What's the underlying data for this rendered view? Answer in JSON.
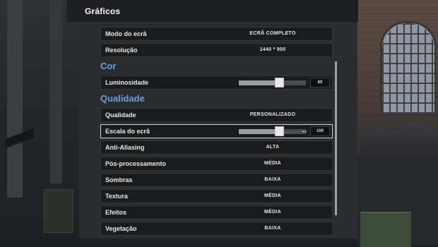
{
  "panel": {
    "title": "Gráficos"
  },
  "rows_top": [
    {
      "label": "Modo do ecrã",
      "value": "ECRÃ COMPLETO"
    },
    {
      "label": "Resolução",
      "value": "1440 * 900"
    }
  ],
  "sections": {
    "color": "Cor",
    "quality": "Qualidade"
  },
  "brightness": {
    "label": "Luminosidade",
    "value": "60",
    "fraction": 0.6
  },
  "quality_preset": {
    "label": "Qualidade",
    "value": "PERSONALIZADO"
  },
  "screen_scale": {
    "label": "Escala do ecrã",
    "value": "100",
    "fraction": 0.6
  },
  "rows_quality": [
    {
      "label": "Anti-Aliasing",
      "value": "ALTA"
    },
    {
      "label": "Pós-processamento",
      "value": "MÉDIA"
    },
    {
      "label": "Sombras",
      "value": "BAIXA"
    },
    {
      "label": "Textura",
      "value": "MÉDIA"
    },
    {
      "label": "Efeitos",
      "value": "MÉDIA"
    },
    {
      "label": "Vegetação",
      "value": "BAIXA"
    }
  ],
  "colors": {
    "section_accent": "#6aa1dc",
    "panel_bg": "#2a2c2f",
    "row_bg": "#1a1b1d"
  },
  "icons": {
    "scale_adjust": "horizontal-arrows-icon"
  }
}
